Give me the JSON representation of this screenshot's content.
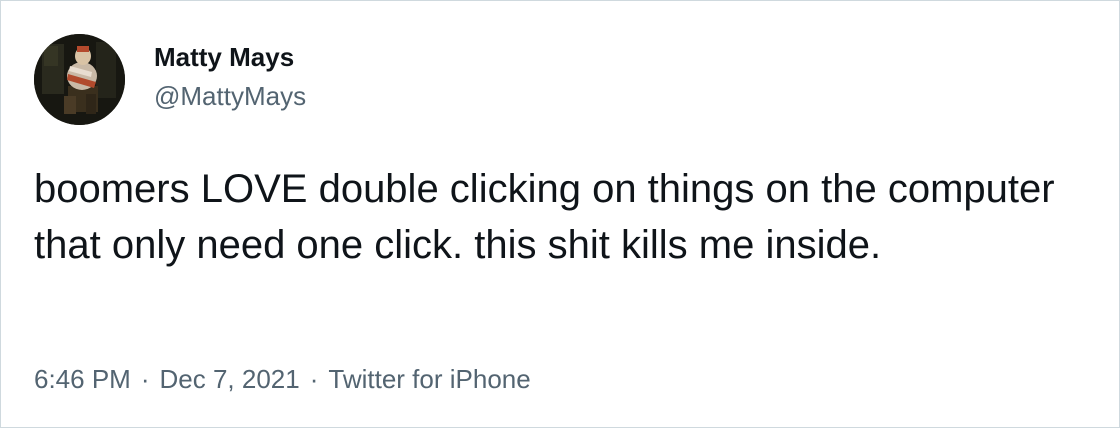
{
  "author": {
    "display_name": "Matty Mays",
    "handle": "@MattyMays",
    "avatar_icon": "user-avatar-photo"
  },
  "tweet": {
    "text": "boomers LOVE double clicking on things on the computer that only need one click. this shit kills me inside.",
    "time": "6:46 PM",
    "date": "Dec 7, 2021",
    "separator": "·",
    "source": "Twitter for iPhone"
  },
  "colors": {
    "text_primary": "#0f1419",
    "text_secondary": "#536471",
    "border": "#cfd9de",
    "background": "#ffffff"
  }
}
